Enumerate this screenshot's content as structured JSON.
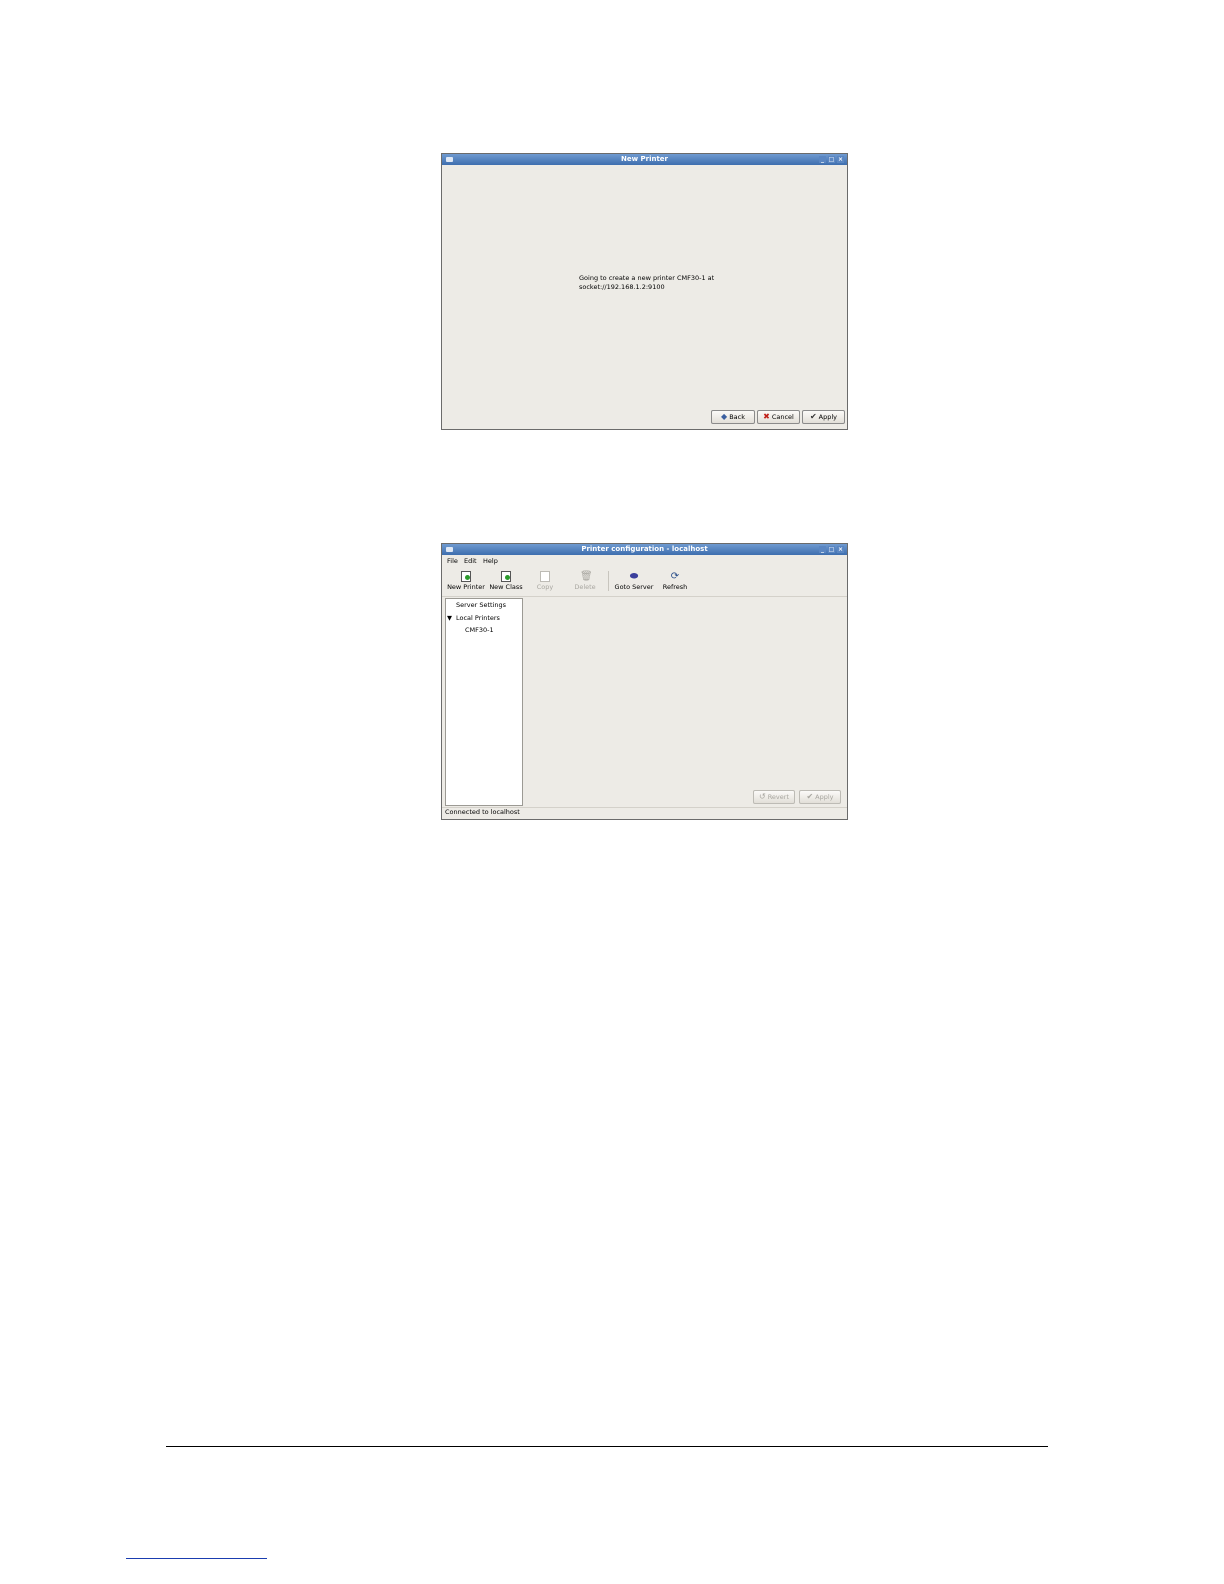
{
  "new_printer_dialog": {
    "title": "New Printer",
    "message": "Going to create a new printer CMF30-1 at\nsocket://192.168.1.2:9100",
    "buttons": {
      "back": "Back",
      "cancel": "Cancel",
      "apply": "Apply"
    }
  },
  "printer_config_window": {
    "title": "Printer configuration - localhost",
    "menu": {
      "file": "File",
      "edit": "Edit",
      "help": "Help"
    },
    "toolbar": {
      "new_printer": "New Printer",
      "new_class": "New Class",
      "copy": "Copy",
      "delete": "Delete",
      "goto_server": "Goto Server",
      "refresh": "Refresh"
    },
    "tree": {
      "server_settings": "Server Settings",
      "local_printers": "Local Printers",
      "printer": "CMF30-1"
    },
    "buttons": {
      "revert": "Revert",
      "apply": "Apply"
    },
    "status": "Connected to localhost"
  },
  "icons": {
    "back": "arrow-left-icon",
    "cancel": "x-icon",
    "apply": "checkmark-icon",
    "tree_expander": "triangle-down-icon"
  },
  "colors": {
    "titlebar": "#3e6eae",
    "window_bg": "#edebe6"
  }
}
